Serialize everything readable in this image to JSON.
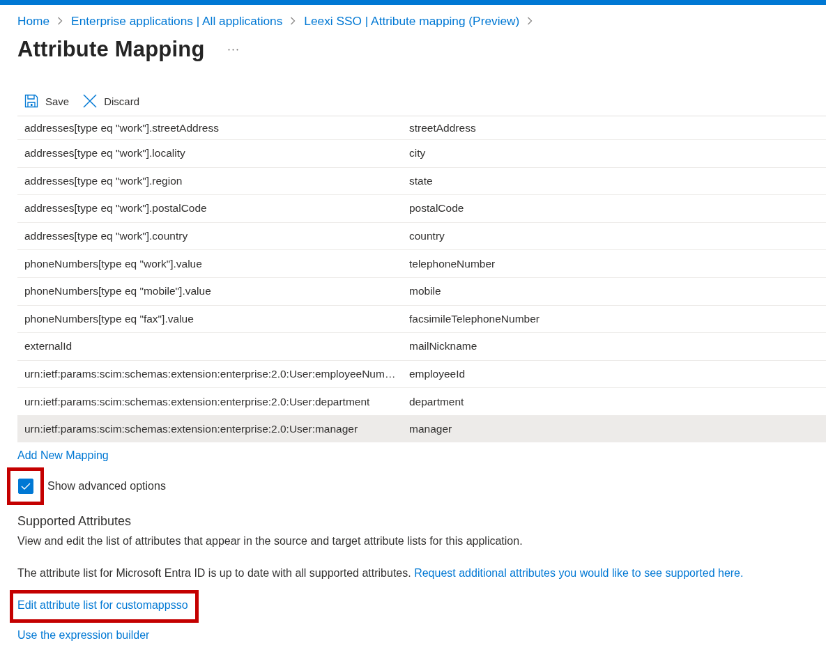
{
  "breadcrumb": [
    "Home",
    "Enterprise applications | All applications",
    "Leexi SSO | Attribute mapping (Preview)"
  ],
  "page": {
    "title": "Attribute Mapping"
  },
  "toolbar": [
    {
      "kind": "save",
      "label": "Save"
    },
    {
      "kind": "discard",
      "label": "Discard"
    }
  ],
  "mapping_table": {
    "rows": [
      {
        "cells": [
          "addresses[type eq \"work\"].streetAddress",
          "streetAddress"
        ],
        "selected": false
      },
      {
        "cells": [
          "addresses[type eq \"work\"].locality",
          "city"
        ],
        "selected": false
      },
      {
        "cells": [
          "addresses[type eq \"work\"].region",
          "state"
        ],
        "selected": false
      },
      {
        "cells": [
          "addresses[type eq \"work\"].postalCode",
          "postalCode"
        ],
        "selected": false
      },
      {
        "cells": [
          "addresses[type eq \"work\"].country",
          "country"
        ],
        "selected": false
      },
      {
        "cells": [
          "phoneNumbers[type eq \"work\"].value",
          "telephoneNumber"
        ],
        "selected": false
      },
      {
        "cells": [
          "phoneNumbers[type eq \"mobile\"].value",
          "mobile"
        ],
        "selected": false
      },
      {
        "cells": [
          "phoneNumbers[type eq \"fax\"].value",
          "facsimileTelephoneNumber"
        ],
        "selected": false
      },
      {
        "cells": [
          "externalId",
          "mailNickname"
        ],
        "selected": false
      },
      {
        "cells": [
          "urn:ietf:params:scim:schemas:extension:enterprise:2.0:User:employeeNum…",
          "employeeId"
        ],
        "selected": false
      },
      {
        "cells": [
          "urn:ietf:params:scim:schemas:extension:enterprise:2.0:User:department",
          "department"
        ],
        "selected": false
      },
      {
        "cells": [
          "urn:ietf:params:scim:schemas:extension:enterprise:2.0:User:manager",
          "manager"
        ],
        "selected": true
      }
    ]
  },
  "add_mapping_link": "Add New Mapping",
  "advanced_options": {
    "label": "Show advanced options",
    "checked": true,
    "highlighted": true
  },
  "supported_attributes": {
    "heading": "Supported Attributes",
    "description": "View and edit the list of attributes that appear in the source and target attribute lists for this application.",
    "status_text": "The attribute list for Microsoft Entra ID is up to date with all supported attributes.",
    "request_link": "Request additional attributes you would like to see supported here.",
    "links": [
      {
        "label": "Edit attribute list for customappsso",
        "highlighted": true
      },
      {
        "label": "Use the expression builder",
        "highlighted": false
      }
    ]
  }
}
